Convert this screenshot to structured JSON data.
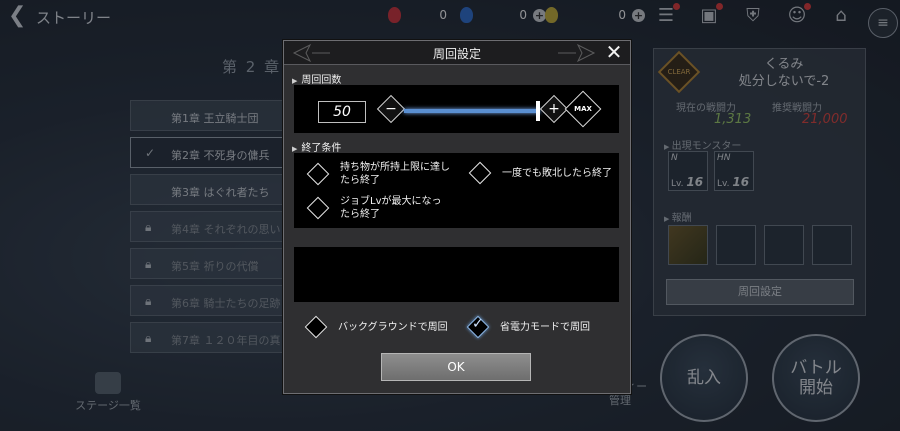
{
  "topbar": {
    "title": "ストーリー",
    "resources": [
      {
        "icon": "red-gem-icon",
        "value": "0",
        "color": "#d2343c"
      },
      {
        "icon": "blue-gem-icon",
        "value": "0",
        "color": "#2f6fd1"
      },
      {
        "icon": "gold-gem-icon",
        "value": "0",
        "color": "#c9b23a"
      }
    ],
    "icons": [
      "gift-icon",
      "present-icon",
      "banner-icon",
      "character-icon",
      "home-icon"
    ]
  },
  "background": {
    "chapter_badge": "第 2 章",
    "chapters": [
      {
        "label": "第1章 王立騎士団",
        "state": "normal"
      },
      {
        "label": "第2章 不死身の傭兵",
        "state": "selected"
      },
      {
        "label": "第3章 はぐれ者たち",
        "state": "normal"
      },
      {
        "label": "第4章 それぞれの思い",
        "state": "locked"
      },
      {
        "label": "第5章 祈りの代償",
        "state": "locked"
      },
      {
        "label": "第6章 騎士たちの足跡",
        "state": "locked"
      },
      {
        "label": "第7章 １２０年目の真",
        "state": "locked"
      }
    ],
    "stage_list_label": "ステージ一覧",
    "party_label": "パーティー\n管理",
    "panel": {
      "clear_badge": "CLEAR",
      "quest_title_1": "くるみ",
      "quest_title_2": "処分しないで-2",
      "current_power_label": "現在の戦闘力",
      "current_power_value": "1,313",
      "recommended_power_label": "推奨戦闘力",
      "recommended_power_value": "21,000",
      "monsters_label": "出現モンスター",
      "monsters": [
        {
          "rank": "N",
          "lv_prefix": "Lv.",
          "lv": "16"
        },
        {
          "rank": "HN",
          "lv_prefix": "Lv.",
          "lv": "16"
        }
      ],
      "rewards_label": "報酬",
      "loop_settings_button": "周回設定"
    },
    "raid_button": "乱入",
    "battle_button_1": "バトル",
    "battle_button_2": "開始"
  },
  "modal": {
    "title": "周回設定",
    "loop_count_section": "周回回数",
    "loop_count_value": "50",
    "minus_label": "−",
    "plus_label": "+",
    "max_label": "MAX",
    "slider_level": 1.0,
    "end_conditions_section": "終了条件",
    "conditions": [
      {
        "label_1": "持ち物が所持上限に達し",
        "label_2": "たら終了",
        "checked": false
      },
      {
        "label_1": "一度でも敗北したら終了",
        "label_2": "",
        "checked": false
      },
      {
        "label_1": "ジョブLvが最大になっ",
        "label_2": "たら終了",
        "checked": false
      }
    ],
    "background_loop_label": "バックグラウンドで周回",
    "background_loop_checked": false,
    "power_saving_label": "省電力モードで周回",
    "power_saving_checked": true,
    "ok_label": "OK"
  },
  "colors": {
    "modal_bg": "#2f2f31",
    "slider": "#5a8fd1",
    "current_power": "#9fd06a",
    "recommended_power": "#e0453f"
  }
}
